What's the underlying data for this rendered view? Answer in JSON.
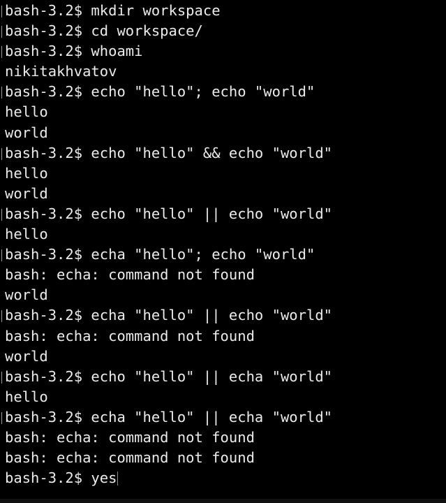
{
  "terminal": {
    "lines": [
      {
        "type": "prompt",
        "text": "bash-3.2$ mkdir workspace"
      },
      {
        "type": "prompt",
        "text": "bash-3.2$ cd workspace/"
      },
      {
        "type": "prompt",
        "text": "bash-3.2$ whoami"
      },
      {
        "type": "output",
        "text": "nikitakhvatov"
      },
      {
        "type": "prompt",
        "text": "bash-3.2$ echo \"hello\"; echo \"world\""
      },
      {
        "type": "output",
        "text": "hello"
      },
      {
        "type": "output",
        "text": "world"
      },
      {
        "type": "prompt",
        "text": "bash-3.2$ echo \"hello\" && echo \"world\""
      },
      {
        "type": "output",
        "text": "hello"
      },
      {
        "type": "output",
        "text": "world"
      },
      {
        "type": "prompt",
        "text": "bash-3.2$ echo \"hello\" || echo \"world\""
      },
      {
        "type": "output",
        "text": "hello"
      },
      {
        "type": "prompt",
        "text": "bash-3.2$ echa \"hello\"; echo \"world\""
      },
      {
        "type": "output",
        "text": "bash: echa: command not found"
      },
      {
        "type": "output",
        "text": "world"
      },
      {
        "type": "prompt",
        "text": "bash-3.2$ echa \"hello\" || echo \"world\""
      },
      {
        "type": "output",
        "text": "bash: echa: command not found"
      },
      {
        "type": "output",
        "text": "world"
      },
      {
        "type": "prompt",
        "text": "bash-3.2$ echo \"hello\" || echa \"world\""
      },
      {
        "type": "output",
        "text": "hello"
      },
      {
        "type": "prompt",
        "text": "bash-3.2$ echa \"hello\" || echa \"world\""
      },
      {
        "type": "output",
        "text": "bash: echa: command not found"
      },
      {
        "type": "output",
        "text": "bash: echa: command not found"
      }
    ],
    "current_input": "bash-3.2$ yes"
  }
}
